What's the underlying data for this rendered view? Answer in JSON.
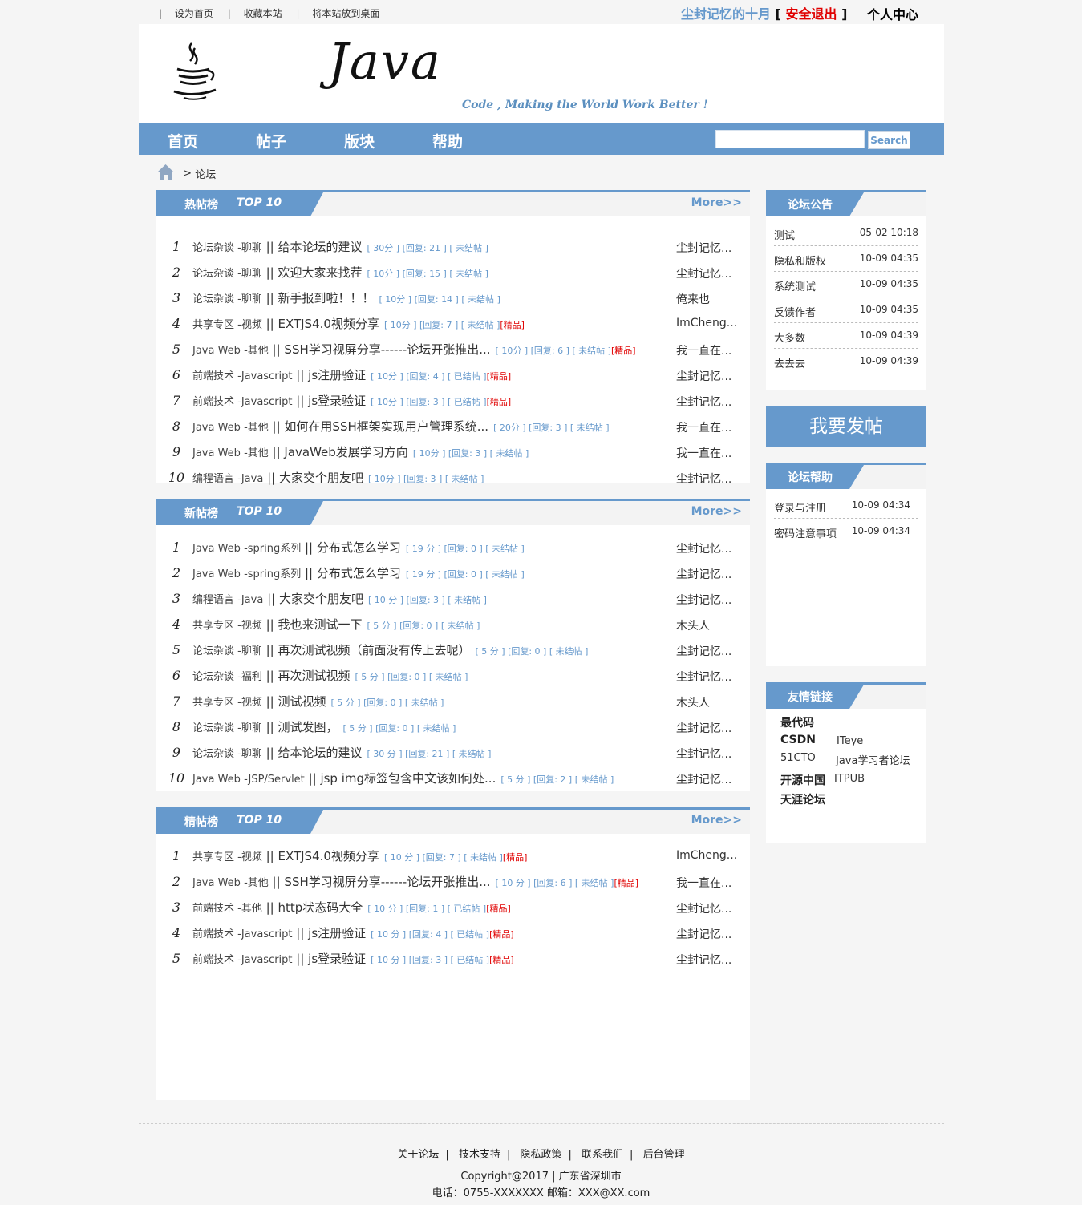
{
  "top": {
    "links": [
      "设为首页",
      "收藏本站",
      "将本站放到桌面"
    ],
    "username": "尘封记忆的十月",
    "logout": "安全退出",
    "lbracket": "[",
    "rbracket": "]",
    "usercenter": "个人中心"
  },
  "header": {
    "logo_word": "Java",
    "slogan": "Code , Making the World Work Better !"
  },
  "nav": {
    "items": [
      "首页",
      "帖子",
      "版块",
      "帮助"
    ],
    "search_placeholder": "",
    "search_button": "Search"
  },
  "breadcrumb": {
    "sep": ">",
    "current": "论坛"
  },
  "hot": {
    "title": "热帖榜",
    "top": "TOP 10",
    "more": "More>>",
    "rows": [
      {
        "n": "1",
        "cat": "论坛杂谈 -聊聊",
        "title": "给本论坛的建议",
        "meta": "[ 30分 ] [回复: 21 ] [ 未结帖 ]",
        "jing": "",
        "author": "尘封记忆..."
      },
      {
        "n": "2",
        "cat": "论坛杂谈 -聊聊",
        "title": "欢迎大家来找茬",
        "meta": "[ 10分 ] [回复: 15 ] [ 未结帖 ]",
        "jing": "",
        "author": "尘封记忆..."
      },
      {
        "n": "3",
        "cat": "论坛杂谈 -聊聊",
        "title": "新手报到啦！！！",
        "meta": "[ 10分 ] [回复: 14 ] [ 未结帖 ]",
        "jing": "",
        "author": "俺来也"
      },
      {
        "n": "4",
        "cat": "共享专区 -视频",
        "title": "EXTJS4.0视频分享",
        "meta": "[ 10分 ] [回复: 7 ] [ 未结帖 ]",
        "jing": "[精品]",
        "author": "ImCheng..."
      },
      {
        "n": "5",
        "cat": "Java Web -其他",
        "title": "SSH学习视屏分享------论坛开张推出...",
        "meta": "[ 10分 ] [回复: 6 ] [ 未结帖 ]",
        "jing": "[精品]",
        "author": "我一直在..."
      },
      {
        "n": "6",
        "cat": "前端技术 -Javascript",
        "title": "js注册验证",
        "meta": "[ 10分 ] [回复: 4 ] [ 已结帖 ]",
        "jing": "[精品]",
        "author": "尘封记忆..."
      },
      {
        "n": "7",
        "cat": "前端技术 -Javascript",
        "title": "js登录验证",
        "meta": "[ 10分 ] [回复: 3 ] [ 已结帖 ]",
        "jing": "[精品]",
        "author": "尘封记忆..."
      },
      {
        "n": "8",
        "cat": "Java Web -其他",
        "title": "如何在用SSH框架实现用户管理系统...",
        "meta": "[ 20分 ] [回复: 3 ] [ 未结帖 ]",
        "jing": "",
        "author": "我一直在..."
      },
      {
        "n": "9",
        "cat": "Java Web -其他",
        "title": "JavaWeb发展学习方向",
        "meta": "[ 10分 ] [回复: 3 ] [ 未结帖 ]",
        "jing": "",
        "author": "我一直在..."
      },
      {
        "n": "10",
        "cat": "编程语言 -Java",
        "title": "大家交个朋友吧",
        "meta": "[ 10分 ] [回复: 3 ] [ 未结帖 ]",
        "jing": "",
        "author": "尘封记忆..."
      }
    ]
  },
  "newp": {
    "title": "新帖榜",
    "top": "TOP 10",
    "more": "More>>",
    "rows": [
      {
        "n": "1",
        "cat": "Java Web -spring系列",
        "title": "分布式怎么学习",
        "meta": "[ 19 分 ] [回复: 0 ] [ 未结帖 ]",
        "jing": "",
        "author": "尘封记忆..."
      },
      {
        "n": "2",
        "cat": "Java Web -spring系列",
        "title": "分布式怎么学习",
        "meta": "[ 19 分 ] [回复: 0 ] [ 未结帖 ]",
        "jing": "",
        "author": "尘封记忆..."
      },
      {
        "n": "3",
        "cat": "编程语言 -Java",
        "title": "大家交个朋友吧",
        "meta": "[ 10 分 ] [回复: 3 ] [ 未结帖 ]",
        "jing": "",
        "author": "尘封记忆..."
      },
      {
        "n": "4",
        "cat": "共享专区 -视频",
        "title": "我也来测试一下",
        "meta": "[ 5 分 ] [回复: 0 ] [ 未结帖 ]",
        "jing": "",
        "author": "木头人"
      },
      {
        "n": "5",
        "cat": "论坛杂谈 -聊聊",
        "title": "再次测试视频（前面没有传上去呢）",
        "meta": "[ 5 分 ] [回复: 0 ] [ 未结帖 ]",
        "jing": "",
        "author": "尘封记忆..."
      },
      {
        "n": "6",
        "cat": "论坛杂谈 -福利",
        "title": "再次测试视频",
        "meta": "[ 5 分 ] [回复: 0 ] [ 未结帖 ]",
        "jing": "",
        "author": "尘封记忆..."
      },
      {
        "n": "7",
        "cat": "共享专区 -视频",
        "title": "测试视频",
        "meta": "[ 5 分 ] [回复: 0 ] [ 未结帖 ]",
        "jing": "",
        "author": "木头人"
      },
      {
        "n": "8",
        "cat": "论坛杂谈 -聊聊",
        "title": "测试发图，",
        "meta": "[ 5 分 ] [回复: 0 ] [ 未结帖 ]",
        "jing": "",
        "author": "尘封记忆..."
      },
      {
        "n": "9",
        "cat": "论坛杂谈 -聊聊",
        "title": "给本论坛的建议",
        "meta": "[ 30 分 ] [回复: 21 ] [ 未结帖 ]",
        "jing": "",
        "author": "尘封记忆..."
      },
      {
        "n": "10",
        "cat": "Java Web -JSP/Servlet",
        "title": "jsp img标签包含中文该如何处...",
        "meta": "[ 5 分 ] [回复: 2 ] [ 未结帖 ]",
        "jing": "",
        "author": "尘封记忆..."
      }
    ]
  },
  "best": {
    "title": "精帖榜",
    "top": "TOP 10",
    "more": "More>>",
    "rows": [
      {
        "n": "1",
        "cat": "共享专区 -视频",
        "title": "EXTJS4.0视频分享",
        "meta": "[ 10 分 ] [回复: 7 ] [ 未结帖 ]",
        "jing": "[精品]",
        "author": "ImCheng..."
      },
      {
        "n": "2",
        "cat": "Java Web -其他",
        "title": "SSH学习视屏分享------论坛开张推出...",
        "meta": "[ 10 分 ] [回复: 6 ] [ 未结帖 ]",
        "jing": "[精品]",
        "author": "我一直在..."
      },
      {
        "n": "3",
        "cat": "前端技术 -其他",
        "title": "http状态码大全",
        "meta": "[ 10 分 ] [回复: 1 ] [ 已结帖 ]",
        "jing": "[精品]",
        "author": "尘封记忆..."
      },
      {
        "n": "4",
        "cat": "前端技术 -Javascript",
        "title": "js注册验证",
        "meta": "[ 10 分 ] [回复: 4 ] [ 已结帖 ]",
        "jing": "[精品]",
        "author": "尘封记忆..."
      },
      {
        "n": "5",
        "cat": "前端技术 -Javascript",
        "title": "js登录验证",
        "meta": "[ 10 分 ] [回复: 3 ] [ 已结帖 ]",
        "jing": "[精品]",
        "author": "尘封记忆..."
      }
    ]
  },
  "notice": {
    "title": "论坛公告",
    "rows": [
      {
        "t": "测试",
        "d": "05-02 10:18"
      },
      {
        "t": "隐私和版权",
        "d": "10-09 04:35"
      },
      {
        "t": "系统测试",
        "d": "10-09 04:35"
      },
      {
        "t": "反馈作者",
        "d": "10-09 04:35"
      },
      {
        "t": "大多数",
        "d": "10-09 04:39"
      },
      {
        "t": "去去去",
        "d": "10-09 04:39"
      }
    ]
  },
  "post_button": "我要发帖",
  "help": {
    "title": "论坛帮助",
    "rows": [
      {
        "t": "登录与注册",
        "d": "10-09 04:34"
      },
      {
        "t": "密码注意事项",
        "d": "10-09 04:34"
      }
    ]
  },
  "links": {
    "title": "友情链接",
    "items": [
      "最代码",
      "CSDN",
      "ITeye",
      "51CTO",
      "Java学习者论坛",
      "开源中国",
      "ITPUB",
      "天涯论坛"
    ]
  },
  "footer": {
    "links": [
      "关于论坛",
      "技术支持",
      "隐私政策",
      "联系我们",
      "后台管理"
    ],
    "copyright": "Copyright@2017 | 广东省深圳市",
    "contact": "电话：0755-XXXXXXX 邮箱：XXX@XX.com"
  },
  "colors": {
    "accent": "#6699cc",
    "hot": "#e00000"
  }
}
